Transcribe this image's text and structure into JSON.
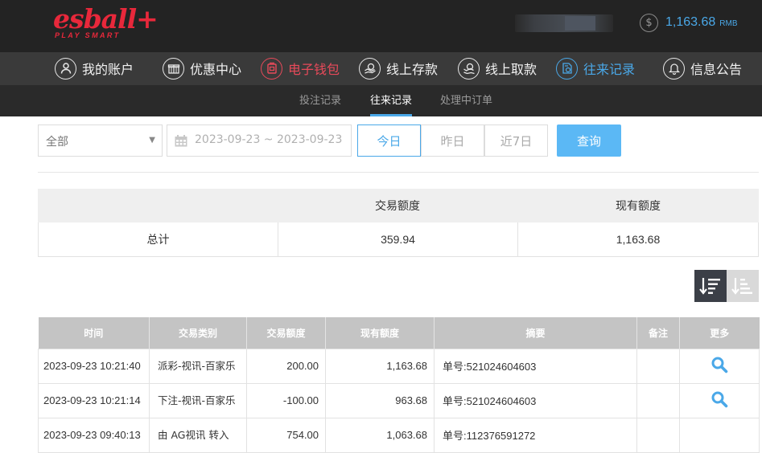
{
  "header": {
    "logo_main": "esball+",
    "logo_sub": "PLAY SMART",
    "coin_symbol": "$",
    "balance": "1,163.68",
    "currency": "RMB"
  },
  "colors": {
    "accent_blue": "#4aa8e8",
    "brand_red": "#e8283b",
    "active_red": "#e84a5a",
    "query_button": "#5bb8f5"
  },
  "nav": {
    "items": [
      {
        "label": "我的账户",
        "icon": "user-icon"
      },
      {
        "label": "优惠中心",
        "icon": "gift-icon"
      },
      {
        "label": "电子钱包",
        "icon": "wallet-icon",
        "state": "active-red"
      },
      {
        "label": "线上存款",
        "icon": "deposit-icon"
      },
      {
        "label": "线上取款",
        "icon": "withdraw-icon"
      },
      {
        "label": "往来记录",
        "icon": "records-icon",
        "state": "active-blue"
      },
      {
        "label": "信息公告",
        "icon": "bell-icon"
      }
    ]
  },
  "subnav": {
    "items": [
      {
        "label": "投注记录"
      },
      {
        "label": "往来记录",
        "active": true
      },
      {
        "label": "处理中订单"
      }
    ]
  },
  "filters": {
    "type_select": "全部",
    "date_range": "2023-09-23 ~ 2023-09-23",
    "quick": [
      "今日",
      "昨日",
      "近7日"
    ],
    "quick_active": "今日",
    "query_label": "查询"
  },
  "summary": {
    "headers": [
      "",
      "交易额度",
      "现有额度"
    ],
    "row": [
      "总计",
      "359.94",
      "1,163.68"
    ]
  },
  "sort": {
    "desc_icon": "sort-descending-icon",
    "asc_icon": "sort-ascending-icon"
  },
  "table": {
    "headers": [
      "时间",
      "交易类别",
      "交易额度",
      "现有额度",
      "摘要",
      "备注",
      "更多"
    ],
    "rows": [
      {
        "time": "2023-09-23 10:21:40",
        "type": "派彩-视讯-百家乐",
        "amount": "200.00",
        "balance": "1,163.68",
        "summary": "单号:521024604603",
        "note": "",
        "more": "search-icon"
      },
      {
        "time": "2023-09-23 10:21:14",
        "type": "下注-视讯-百家乐",
        "amount": "-100.00",
        "balance": "963.68",
        "summary": "单号:521024604603",
        "note": "",
        "more": "search-icon"
      },
      {
        "time": "2023-09-23 09:40:13",
        "type": "由 AG视讯 转入",
        "amount": "754.00",
        "balance": "1,063.68",
        "summary": "单号:112376591272",
        "note": "",
        "more": ""
      }
    ]
  }
}
